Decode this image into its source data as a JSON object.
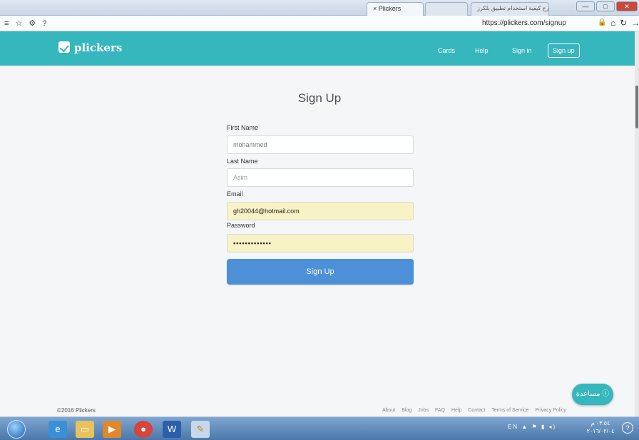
{
  "browser": {
    "tabs": [
      {
        "label": "× Plickers"
      },
      {
        "label": ""
      },
      {
        "label": "شرح كيفية استخدام تطبيق بلكرز"
      }
    ],
    "url_prefix": "https://",
    "url_domain": "plickers.com",
    "url_path": "/signup",
    "nav_icons": "≡ ☆ ⚙ ?"
  },
  "site": {
    "logo": "plickers",
    "nav": {
      "cards": "Cards",
      "help": "Help",
      "signin": "Sign in",
      "signup": "Sign up"
    }
  },
  "form": {
    "title": "Sign Up",
    "first_name_label": "First Name",
    "first_name_value": "mohammed",
    "last_name_label": "Last Name",
    "last_name_value": "Asim",
    "email_label": "Email",
    "email_value": "gh20044@hotmail.com",
    "password_label": "Password",
    "password_value": "•••••••••••••",
    "submit_label": "Sign Up"
  },
  "footer": {
    "copyright": "©2016 Plickers",
    "links": [
      "About",
      "Blog",
      "Jobs",
      "FAQ",
      "Help",
      "Contact",
      "Terms of Service",
      "Privacy Policy"
    ]
  },
  "help_button": {
    "label": "مساعدة ⓘ"
  },
  "taskbar": {
    "apps": [
      "ie-icon",
      "folder-icon",
      "media-player-icon",
      "chrome-icon",
      "word-icon",
      "paint-icon"
    ],
    "tray_text": "EN ▲ ⚑ ▮ ◂)",
    "clock_time": "٠٣:٥٤ م",
    "clock_date": "٢٠١٦/٠٢/٠٤"
  }
}
